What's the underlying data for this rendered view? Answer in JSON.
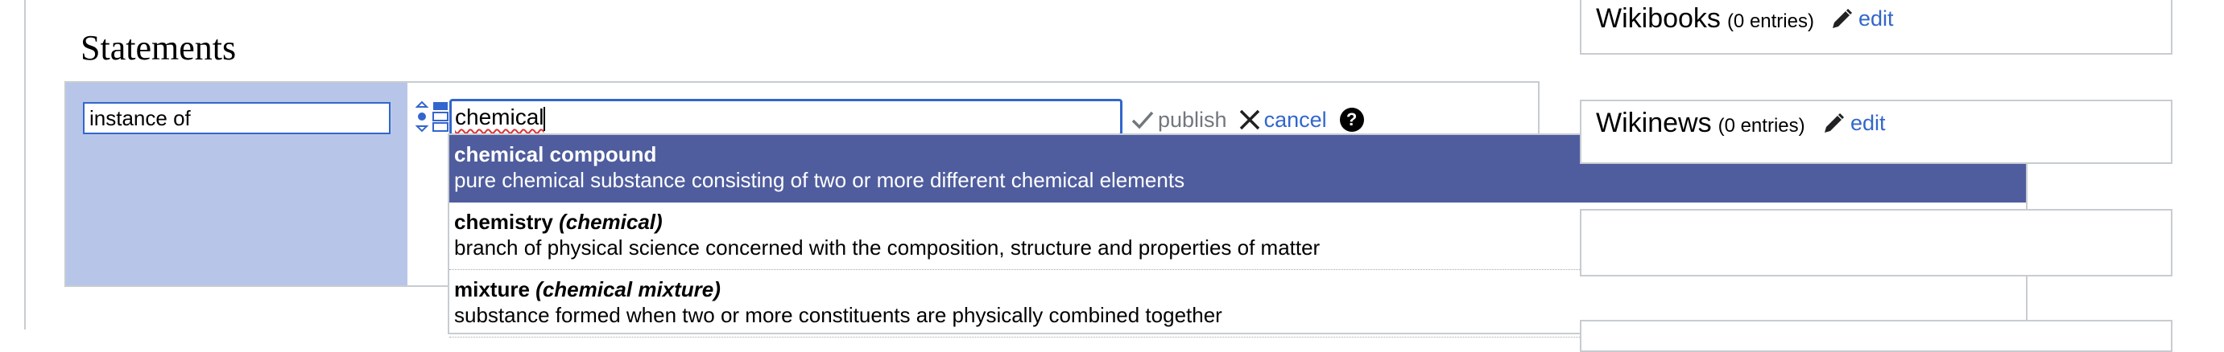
{
  "section": {
    "heading": "Statements"
  },
  "statement": {
    "property": "instance of",
    "value_typed": "chemical",
    "publish_label": "publish",
    "cancel_label": "cancel",
    "help_label": "?"
  },
  "suggestions": [
    {
      "label": "chemical compound",
      "alias": "",
      "description": "pure chemical substance consisting of two or more different chemical elements",
      "highlighted": true
    },
    {
      "label": "chemistry",
      "alias": "(chemical)",
      "description": "branch of physical science concerned with the composition, structure and properties of matter",
      "highlighted": false
    },
    {
      "label": "mixture",
      "alias": "(chemical mixture)",
      "description": "substance formed when two or more constituents are physically combined together",
      "highlighted": false
    }
  ],
  "sitelinks": [
    {
      "name": "Wikibooks",
      "count": "(0 entries)",
      "edit_label": "edit"
    },
    {
      "name": "Wikinews",
      "count": "(0 entries)",
      "edit_label": "edit"
    }
  ],
  "colors": {
    "property_bg": "#b7c6e8",
    "suggestion_highlight": "#4f5d9e",
    "link": "#3366cc",
    "focus_border": "#3366cc"
  },
  "icons": {
    "rank": "rank-selector-icon",
    "publish": "checkmark-icon",
    "cancel": "close-icon",
    "help": "help-icon",
    "edit": "pencil-icon"
  }
}
